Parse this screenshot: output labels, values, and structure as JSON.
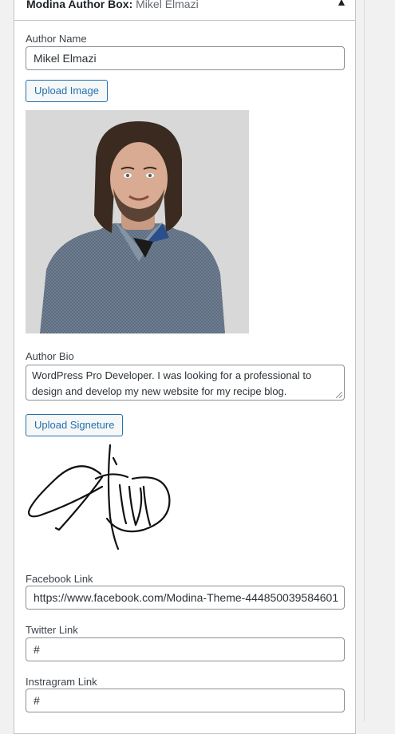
{
  "metabox": {
    "title": "Modina Author Box:",
    "title_sub": "Mikel Elmazi",
    "toggle_icon": "caret-up-icon"
  },
  "author_name": {
    "label": "Author Name",
    "value": "Mikel Elmazi"
  },
  "upload_image_button": "Upload Image",
  "author_photo": {
    "icon": "author-photo",
    "background": "#d8d8d8"
  },
  "author_bio": {
    "label": "Author Bio",
    "value": "WordPress Pro Developer. I was looking for a professional to design and develop my new website for my recipe blog."
  },
  "upload_signature_button": "Upload Signeture",
  "facebook_link": {
    "label": "Facebook Link",
    "value": "https://www.facebook.com/Modina-Theme-444850039584601"
  },
  "twitter_link": {
    "label": "Twitter Link",
    "value": "#"
  },
  "instagram_link": {
    "label": "Instragram Link",
    "value": "#"
  },
  "colors": {
    "accent": "#2271b1",
    "border": "#8c8f94",
    "panel_border": "#c3c4c7"
  }
}
